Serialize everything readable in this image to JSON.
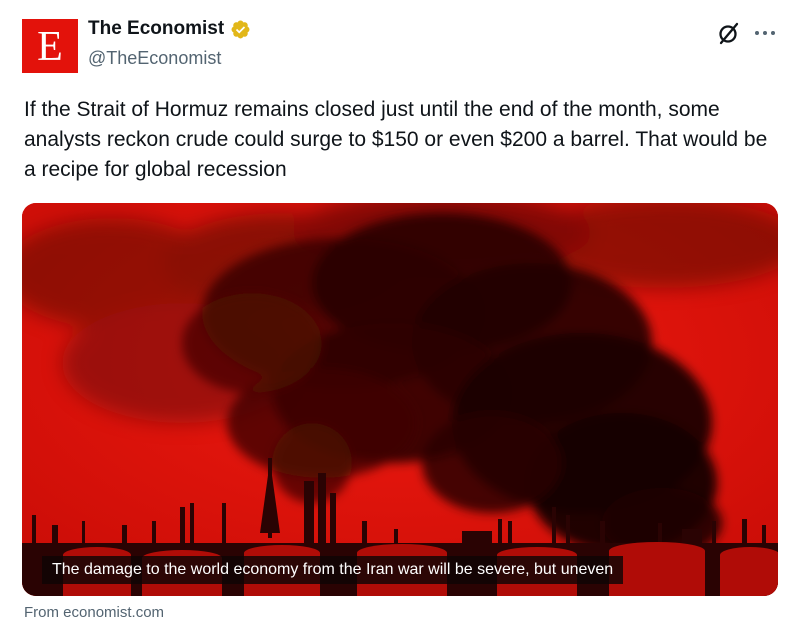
{
  "author": {
    "avatar_letter": "E",
    "display_name": "The Economist",
    "handle": "@TheEconomist",
    "verified": true,
    "avatar_color": "#e3120b",
    "verified_badge_color": "#e2b719"
  },
  "actions": {
    "grok_icon": "grok-icon",
    "more_icon": "more-icon"
  },
  "tweet": {
    "text": "If the Strait of Hormuz remains closed just until the end of the month, some analysts reckon crude could surge to $150 or even $200 a barrel. That would be a recipe for global recession"
  },
  "card": {
    "caption": "The damage to the world economy from the Iran war will be severe, but uneven",
    "source": "From economist.com",
    "image_tint": "#d8100a"
  }
}
